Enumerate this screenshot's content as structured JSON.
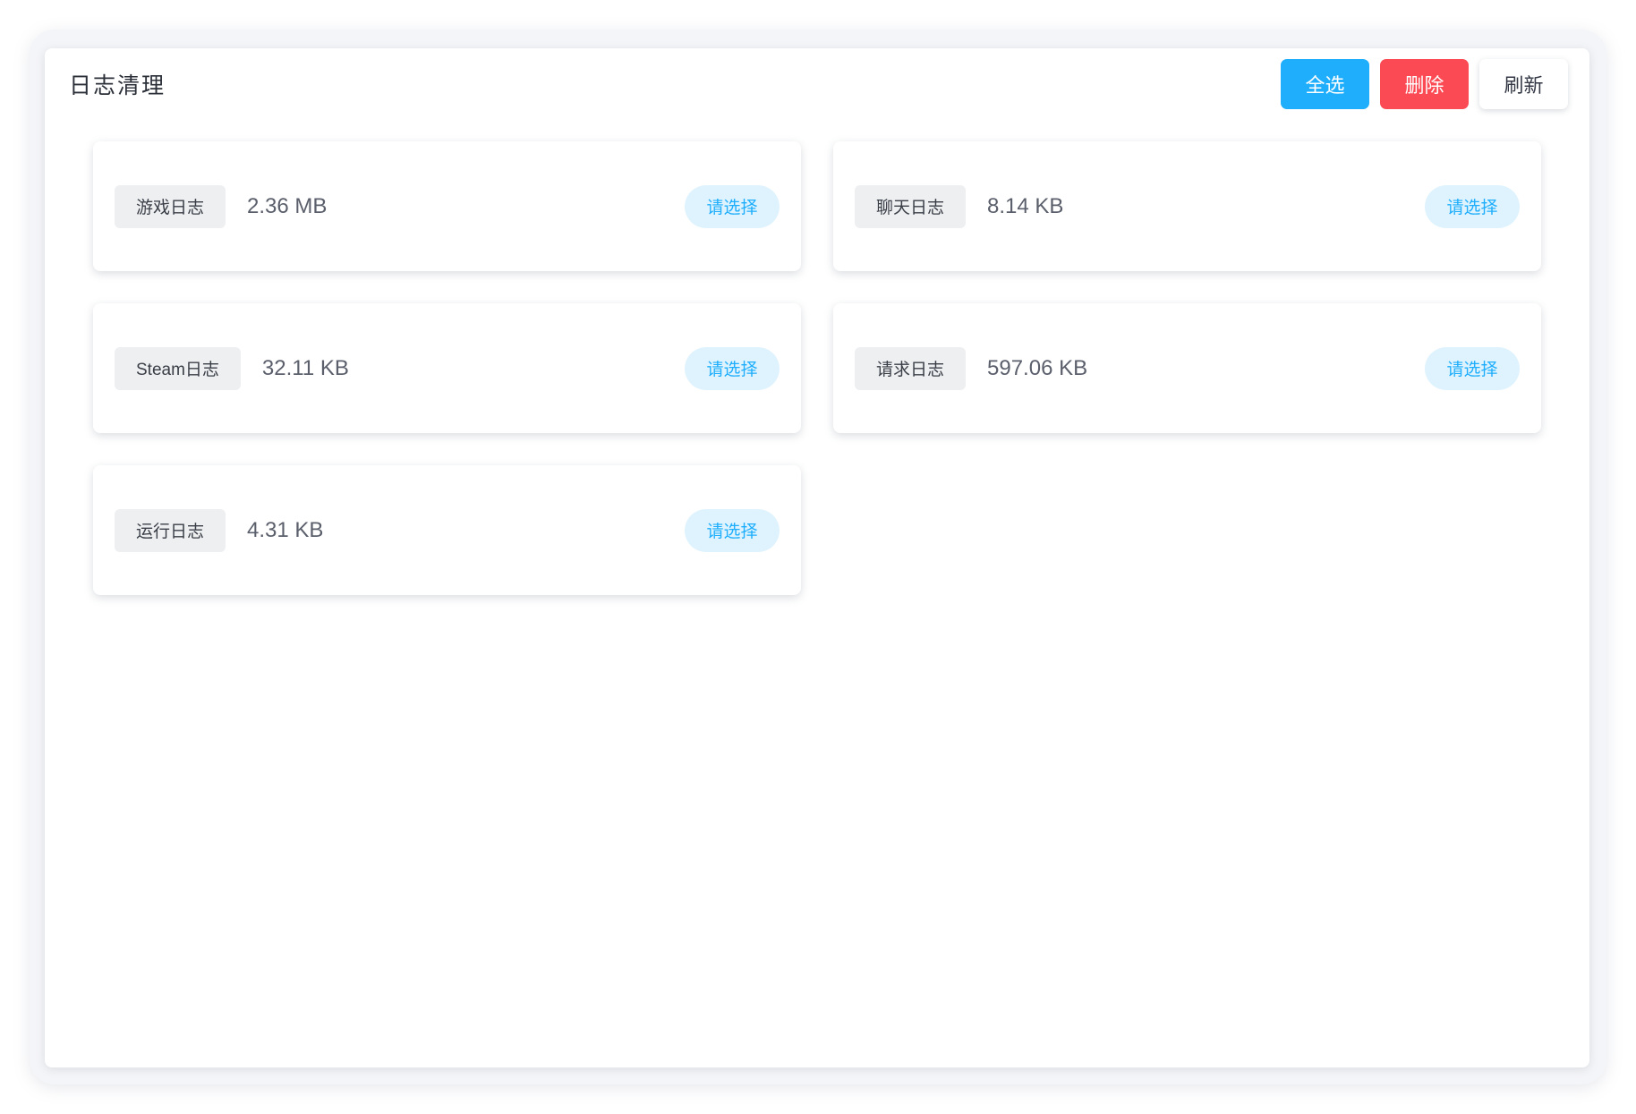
{
  "header": {
    "title": "日志清理"
  },
  "toolbar": {
    "select_all_label": "全选",
    "delete_label": "删除",
    "refresh_label": "刷新"
  },
  "colors": {
    "primary": "#1eaefc",
    "danger": "#fb4a53",
    "pill_bg": "#dff3fe",
    "tag_bg": "#eeeff1"
  },
  "logs": [
    {
      "name": "游戏日志",
      "size": "2.36 MB",
      "action": "请选择"
    },
    {
      "name": "聊天日志",
      "size": "8.14 KB",
      "action": "请选择"
    },
    {
      "name": "Steam日志",
      "size": "32.11 KB",
      "action": "请选择"
    },
    {
      "name": "请求日志",
      "size": "597.06 KB",
      "action": "请选择"
    },
    {
      "name": "运行日志",
      "size": "4.31 KB",
      "action": "请选择"
    }
  ]
}
